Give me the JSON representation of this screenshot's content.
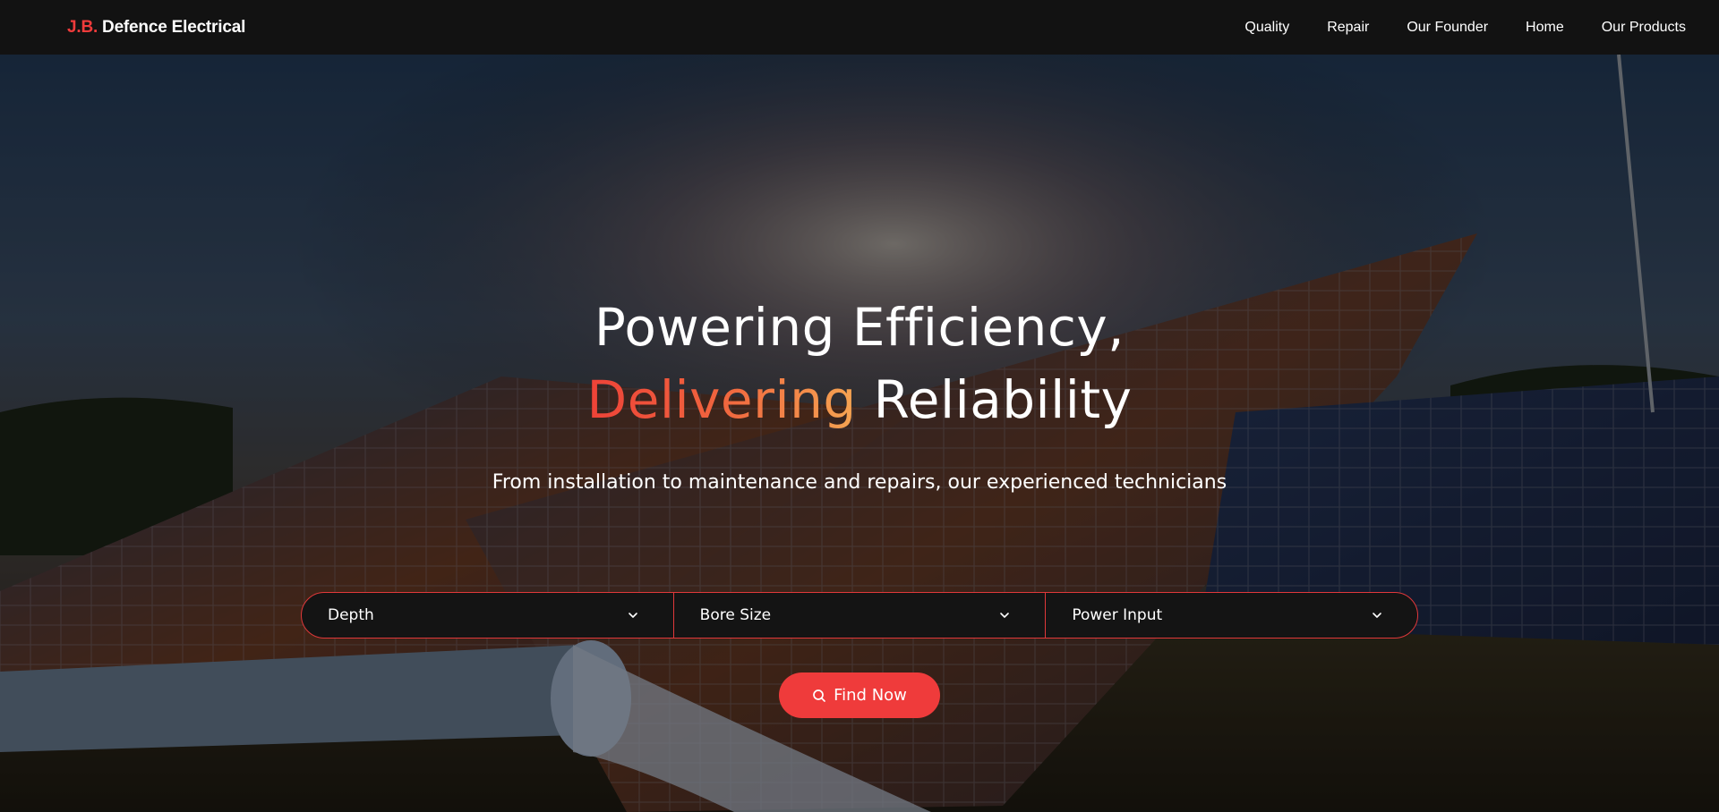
{
  "nav": {
    "logo_accent": "J.B.",
    "logo_name": "Defence Electrical",
    "links": [
      "Quality",
      "Repair",
      "Our Founder",
      "Home",
      "Our Products"
    ]
  },
  "hero": {
    "headline_line1": "Powering Efficiency,",
    "headline_highlight": "Delivering",
    "headline_rest": "Reliability",
    "subtitle": "From installation to maintenance and repairs, our experienced technicians",
    "filters": [
      {
        "label": "Depth",
        "icon": "chevron-down-icon"
      },
      {
        "label": "Bore Size",
        "icon": "chevron-down-icon"
      },
      {
        "label": "Power Input",
        "icon": "chevron-down-icon"
      }
    ],
    "find_button": {
      "label": "Find Now",
      "icon": "search-icon"
    }
  },
  "colors": {
    "accent": "#ef3b3b",
    "nav_bg": "#121212",
    "gradient_start": "#ee4238",
    "gradient_end": "#f5a552"
  }
}
